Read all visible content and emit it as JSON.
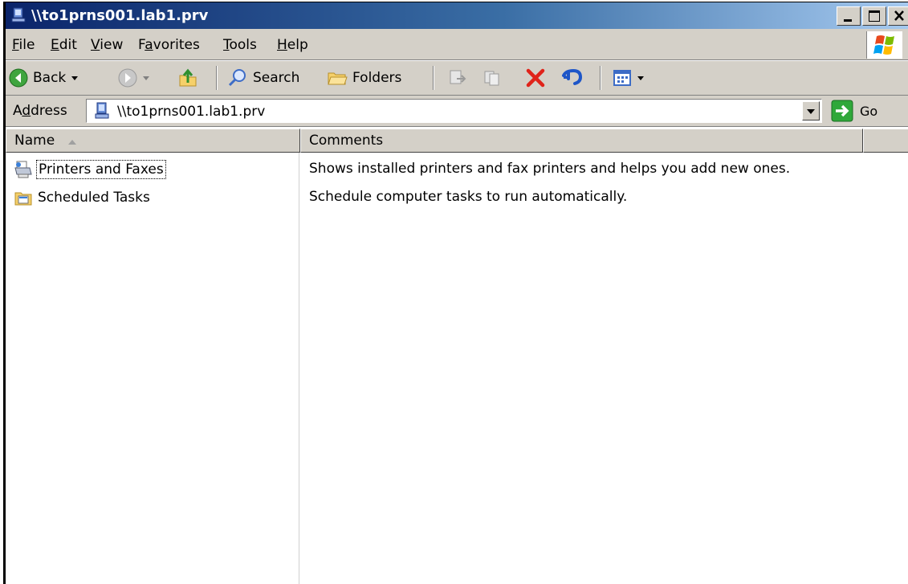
{
  "window": {
    "title": "\\\\to1prns001.lab1.prv"
  },
  "menu": {
    "items": [
      {
        "label": "File",
        "accel": "F",
        "rest": "ile"
      },
      {
        "label": "Edit",
        "accel": "E",
        "rest": "dit"
      },
      {
        "label": "View",
        "accel": "V",
        "rest": "iew"
      },
      {
        "label": "Favorites",
        "pre": "F",
        "accel": "a",
        "rest": "vorites"
      },
      {
        "label": "Tools",
        "accel": "T",
        "rest": "ools"
      },
      {
        "label": "Help",
        "accel": "H",
        "rest": "elp"
      }
    ]
  },
  "toolbar": {
    "back_label": "Back",
    "search_label": "Search",
    "folders_label": "Folders"
  },
  "address": {
    "label_pre": "A",
    "label_accel": "d",
    "label_rest": "dress",
    "value": "\\\\to1prns001.lab1.prv",
    "go_label": "Go"
  },
  "list": {
    "columns": [
      "Name",
      "Comments"
    ],
    "items": [
      {
        "name": "Printers and Faxes",
        "comment": "Shows installed printers and fax printers and helps you add new ones.",
        "icon": "printer-folder-icon"
      },
      {
        "name": "Scheduled Tasks",
        "comment": "Schedule computer tasks to run automatically.",
        "icon": "scheduled-tasks-icon"
      }
    ]
  },
  "colors": {
    "title_start": "#0a246a",
    "title_end": "#a6caf0",
    "chrome": "#d4d0c8"
  }
}
